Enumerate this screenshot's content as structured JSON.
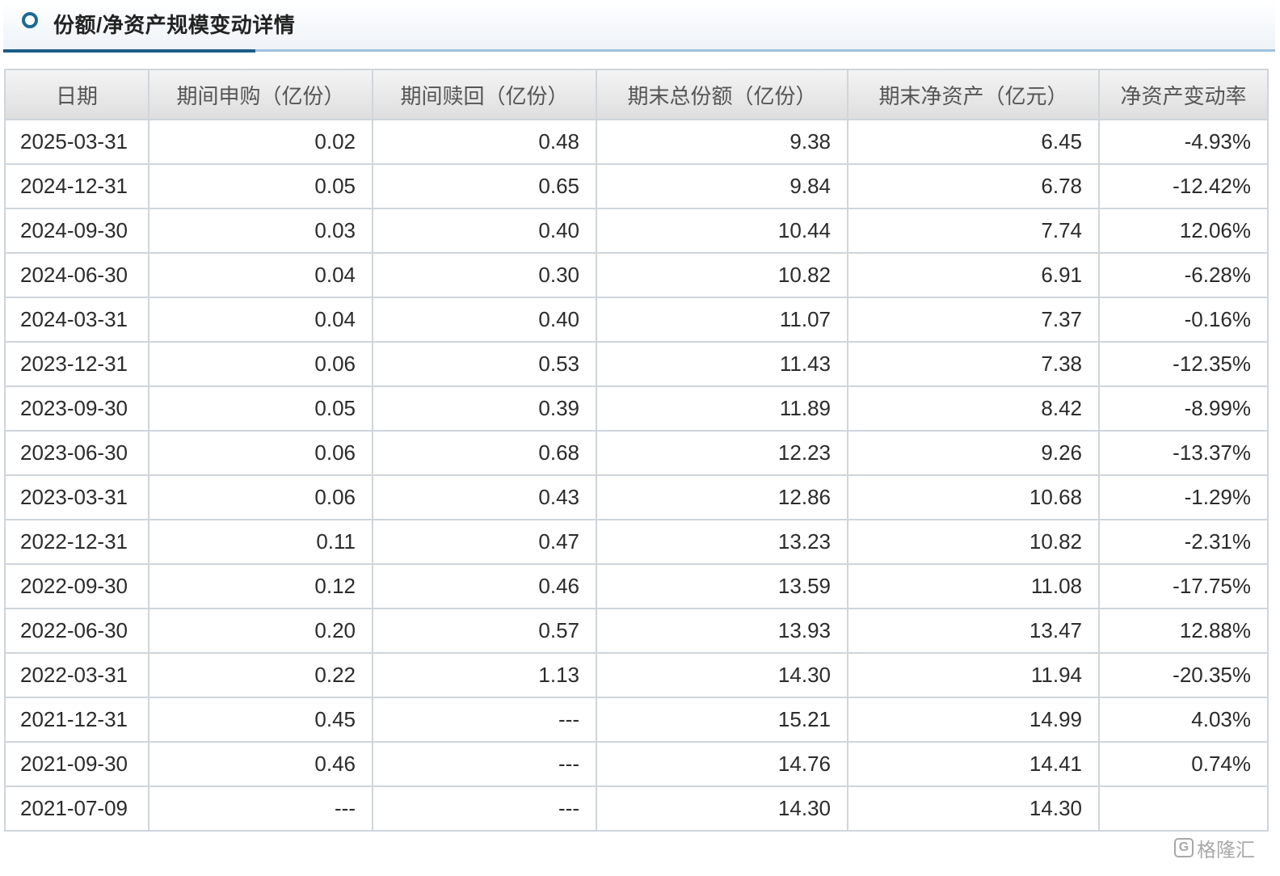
{
  "panel": {
    "title": "份额/净资产规模变动详情"
  },
  "table": {
    "headers": [
      "日期",
      "期间申购（亿份）",
      "期间赎回（亿份）",
      "期末总份额（亿份）",
      "期末净资产（亿元）",
      "净资产变动率"
    ],
    "rows": [
      [
        "2025-03-31",
        "0.02",
        "0.48",
        "9.38",
        "6.45",
        "-4.93%"
      ],
      [
        "2024-12-31",
        "0.05",
        "0.65",
        "9.84",
        "6.78",
        "-12.42%"
      ],
      [
        "2024-09-30",
        "0.03",
        "0.40",
        "10.44",
        "7.74",
        "12.06%"
      ],
      [
        "2024-06-30",
        "0.04",
        "0.30",
        "10.82",
        "6.91",
        "-6.28%"
      ],
      [
        "2024-03-31",
        "0.04",
        "0.40",
        "11.07",
        "7.37",
        "-0.16%"
      ],
      [
        "2023-12-31",
        "0.06",
        "0.53",
        "11.43",
        "7.38",
        "-12.35%"
      ],
      [
        "2023-09-30",
        "0.05",
        "0.39",
        "11.89",
        "8.42",
        "-8.99%"
      ],
      [
        "2023-06-30",
        "0.06",
        "0.68",
        "12.23",
        "9.26",
        "-13.37%"
      ],
      [
        "2023-03-31",
        "0.06",
        "0.43",
        "12.86",
        "10.68",
        "-1.29%"
      ],
      [
        "2022-12-31",
        "0.11",
        "0.47",
        "13.23",
        "10.82",
        "-2.31%"
      ],
      [
        "2022-09-30",
        "0.12",
        "0.46",
        "13.59",
        "11.08",
        "-17.75%"
      ],
      [
        "2022-06-30",
        "0.20",
        "0.57",
        "13.93",
        "13.47",
        "12.88%"
      ],
      [
        "2022-03-31",
        "0.22",
        "1.13",
        "14.30",
        "11.94",
        "-20.35%"
      ],
      [
        "2021-12-31",
        "0.45",
        "---",
        "15.21",
        "14.99",
        "4.03%"
      ],
      [
        "2021-09-30",
        "0.46",
        "---",
        "14.76",
        "14.41",
        "0.74%"
      ],
      [
        "2021-07-09",
        "---",
        "---",
        "14.30",
        "14.30",
        ""
      ]
    ]
  },
  "watermark": {
    "text": "格隆汇",
    "icon": "gelonghui-logo-icon"
  },
  "colors": {
    "accent": "#1a5e86",
    "header_line": "#9fc1dc",
    "grid": "#cfd5db"
  }
}
